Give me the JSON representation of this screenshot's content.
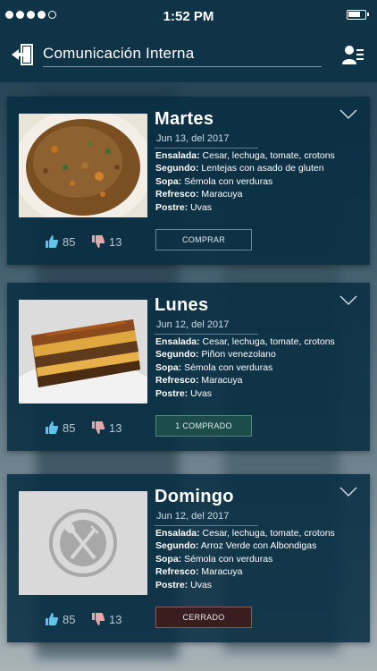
{
  "status": {
    "time": "1:52 PM"
  },
  "header": {
    "title": "Comunicación Interna"
  },
  "cards": [
    {
      "day": "Martes",
      "date": "Jun 13, del 2017",
      "menu": [
        {
          "label": "Ensalada:",
          "value": "Cesar, lechuga, tomate, crotons"
        },
        {
          "label": "Segundo:",
          "value": "Lentejas con asado de gluten"
        },
        {
          "label": "Sopa:",
          "value": "Sémola con verduras"
        },
        {
          "label": "Refresco:",
          "value": "Maracuya"
        },
        {
          "label": "Postre:",
          "value": "Uvas"
        }
      ],
      "likes": "85",
      "dislikes": "13",
      "button": "COMPRAR"
    },
    {
      "day": "Lunes",
      "date": "Jun 12, del 2017",
      "menu": [
        {
          "label": "Ensalada:",
          "value": "Cesar, lechuga, tomate, crotons"
        },
        {
          "label": "Segundo:",
          "value": "Piñon venezolano"
        },
        {
          "label": "Sopa:",
          "value": "Sémola con verduras"
        },
        {
          "label": "Refresco:",
          "value": "Maracuya"
        },
        {
          "label": "Postre:",
          "value": "Uvas"
        }
      ],
      "likes": "85",
      "dislikes": "13",
      "button": "1 COMPRADO"
    },
    {
      "day": "Domingo",
      "date": "Jun 12, del 2017",
      "menu": [
        {
          "label": "Ensalada:",
          "value": "Cesar, lechuga, tomate, crotons"
        },
        {
          "label": "Segundo:",
          "value": "Arroz Verde con Albondigas"
        },
        {
          "label": "Sopa:",
          "value": "Sémola con verduras"
        },
        {
          "label": "Refresco:",
          "value": "Maracuya"
        },
        {
          "label": "Postre:",
          "value": "Uvas"
        }
      ],
      "likes": "85",
      "dislikes": "13",
      "button": "CERRADO"
    }
  ],
  "icons": {
    "exit": "exit-door-icon",
    "profile": "profile-list-icon",
    "expand": "chevron-down-icon",
    "like": "thumbs-up-icon",
    "dislike": "thumbs-down-icon"
  },
  "colors": {
    "header_bg": "#0f3347",
    "card_bg": "#082e42",
    "like_icon": "#5fc3ea",
    "dislike_icon": "#e8a8a8",
    "bought_button": "#1d4d48",
    "closed_button": "#3a1d1f"
  }
}
